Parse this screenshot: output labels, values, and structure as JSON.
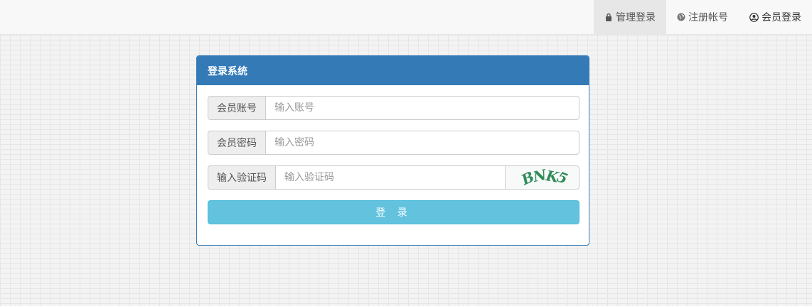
{
  "nav": {
    "items": [
      {
        "label": "管理登录",
        "icon": "lock-icon",
        "active": true
      },
      {
        "label": "注册帐号",
        "icon": "globe-icon",
        "active": false
      },
      {
        "label": "会员登录",
        "icon": "user-circle-icon",
        "active": false
      }
    ]
  },
  "panel": {
    "title": "登录系统",
    "account": {
      "label": "会员账号",
      "placeholder": "输入账号",
      "value": ""
    },
    "password": {
      "label": "会员密码",
      "placeholder": "输入密码",
      "value": ""
    },
    "captcha": {
      "label": "输入验证码",
      "placeholder": "输入验证码",
      "value": "",
      "image_text": "BNK5"
    },
    "submit_label": "登 录"
  },
  "colors": {
    "primary": "#337ab7",
    "info": "#5bc0de",
    "captcha_text": "#2e8b57"
  }
}
